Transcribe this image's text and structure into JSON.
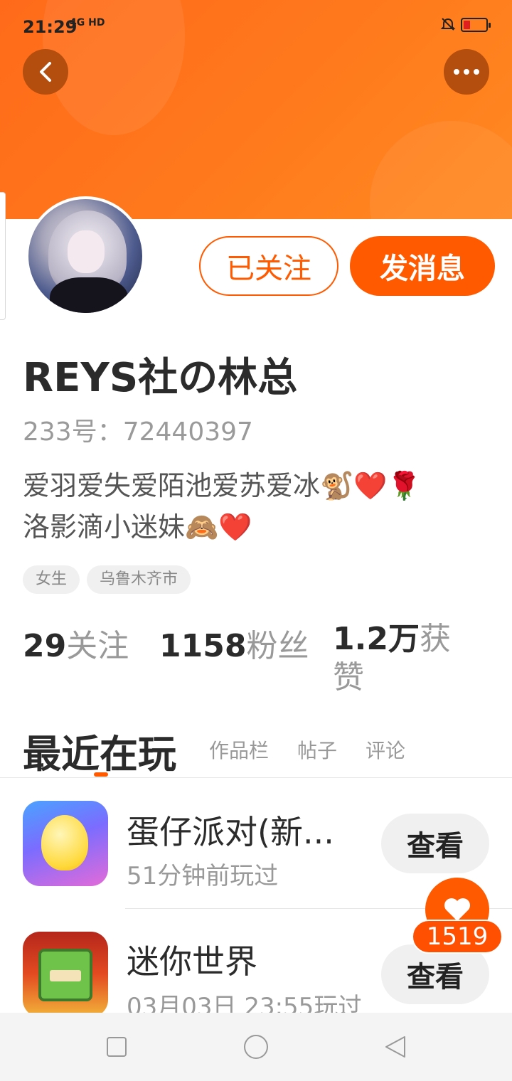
{
  "status_bar": {
    "time": "21:29",
    "network": "4G HD",
    "icons": [
      "signal-icon",
      "mute-bell-icon",
      "battery-icon"
    ]
  },
  "header": {
    "back_icon": "chevron-left-icon",
    "more_icon": "more-dots-icon",
    "gradient_colors": [
      "#ff6a1a",
      "#ff8a22"
    ]
  },
  "profile": {
    "follow_button": "已关注",
    "message_button": "发消息",
    "name": "REYS社の林总",
    "id_label": "233号：72440397",
    "bio_line1": "爱羽爱失爱陌池爱苏爱冰🐒❤️🌹",
    "bio_line2": "洛影滴小迷妹🙈❤️",
    "tags": [
      "女生",
      "乌鲁木齐市"
    ]
  },
  "stats": {
    "following_count": "29",
    "following_label": "关注",
    "followers_count": "1158",
    "followers_label": "粉丝",
    "likes_count": "1.2万",
    "likes_label": "获赞"
  },
  "tabs": {
    "active": "最近在玩",
    "items": [
      "作品栏",
      "帖子",
      "评论"
    ]
  },
  "games": [
    {
      "title": "蛋仔派对(新...",
      "time": "51分钟前玩过",
      "button": "查看"
    },
    {
      "title": "迷你世界",
      "time": "03月03日 23:55玩过",
      "button": "查看"
    }
  ],
  "floating_like": {
    "icon": "heart-icon",
    "count": "1519"
  },
  "nav": {
    "icons": [
      "square-icon",
      "circle-icon",
      "triangle-back-icon"
    ]
  },
  "colors": {
    "accent": "#ff5a00",
    "muted_text": "#999999"
  }
}
